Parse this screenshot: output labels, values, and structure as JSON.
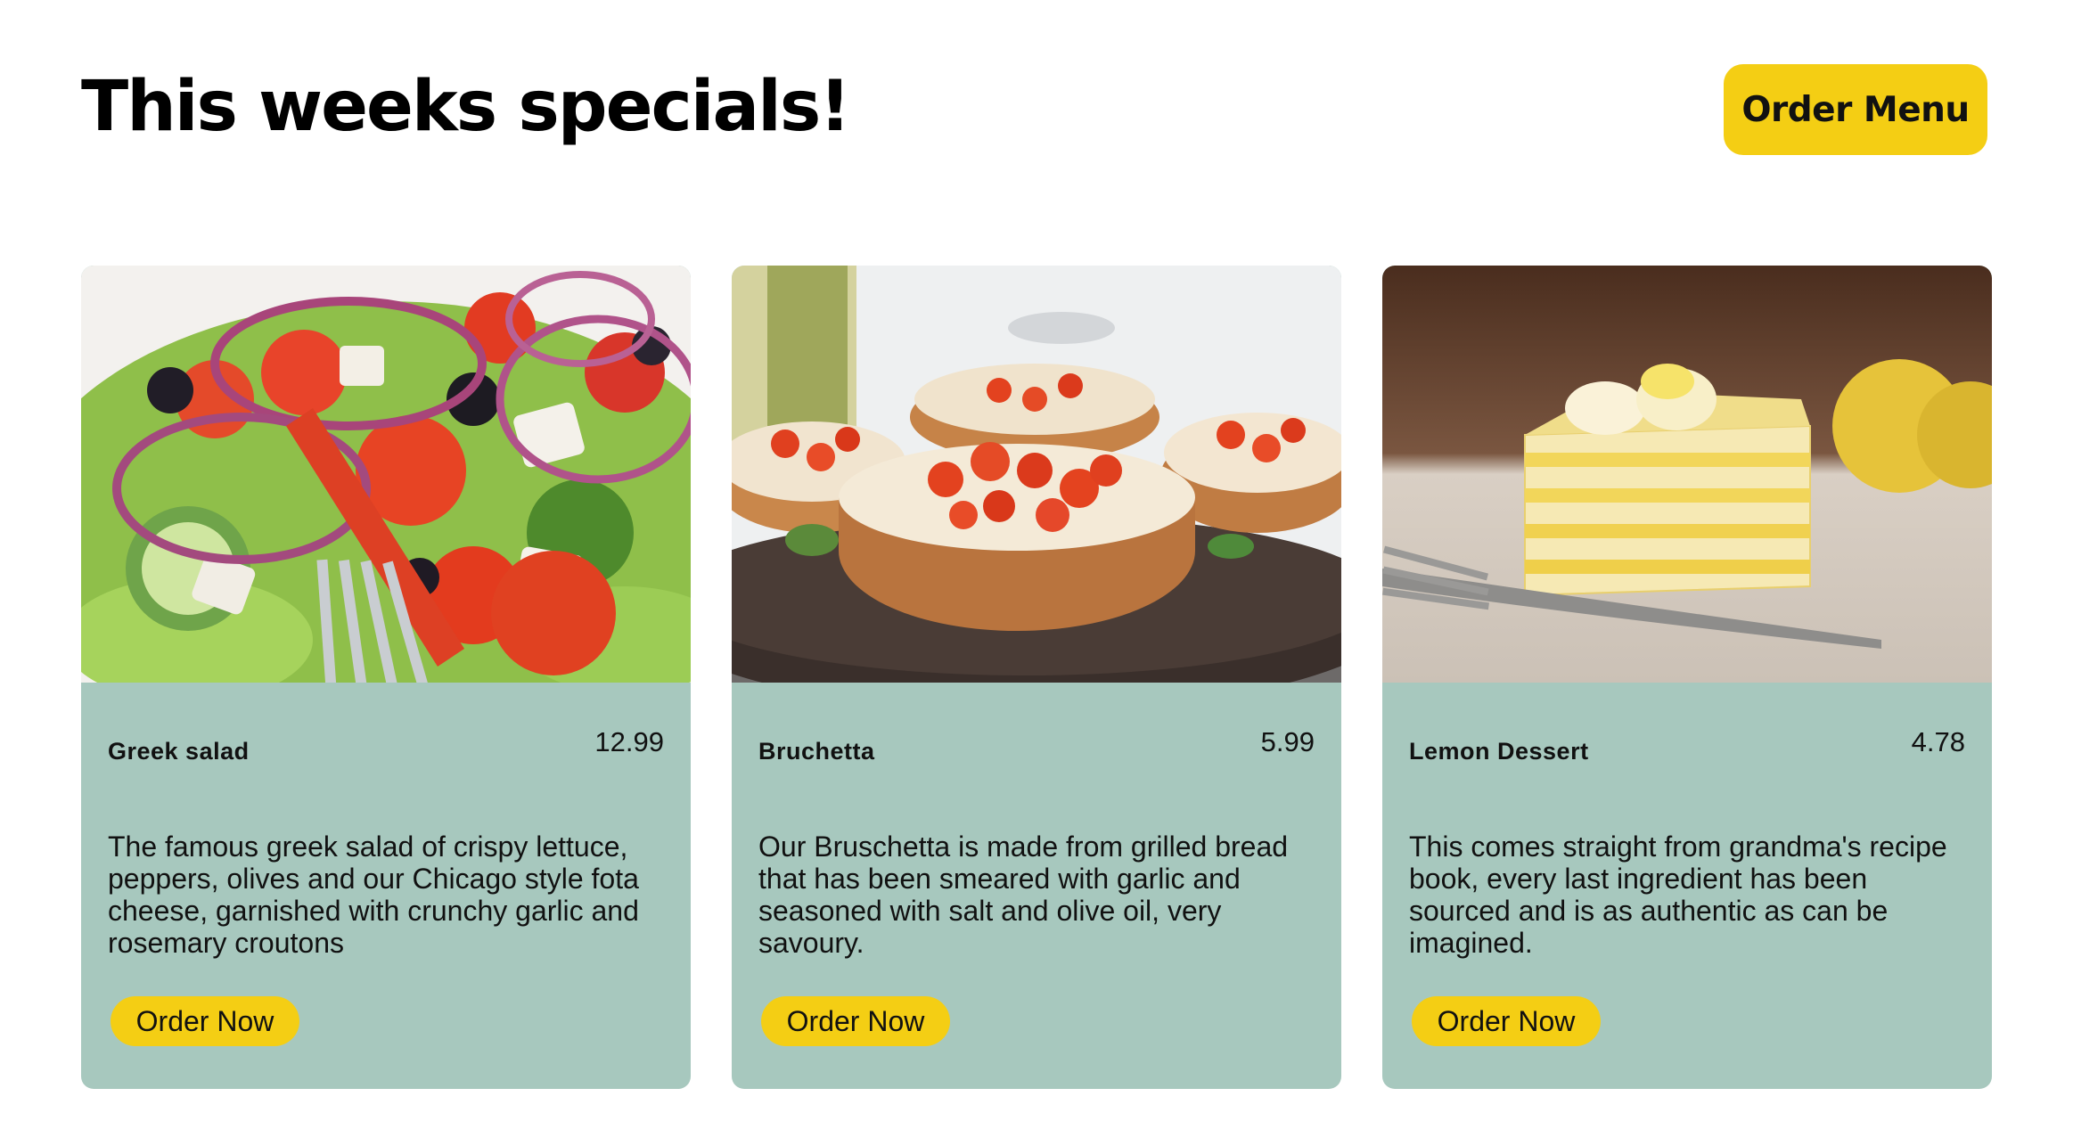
{
  "header": {
    "title": "This weeks specials!",
    "order_menu_label": "Order Menu"
  },
  "colors": {
    "accent_yellow": "#f4ce14",
    "card_background": "#a7c8be",
    "text": "#111111"
  },
  "cards": [
    {
      "name": "Greek salad",
      "price": "12.99",
      "description": "The famous greek salad of crispy lettuce, peppers, olives and our Chicago style fota cheese, garnished with crunchy garlic and rosemary croutons",
      "button_label": "Order Now",
      "image_icon": "greek-salad-photo"
    },
    {
      "name": "Bruchetta",
      "price": "5.99",
      "description": "Our Bruschetta is made from grilled bread that has been smeared with garlic and seasoned with salt and olive oil, very savoury.",
      "button_label": "Order Now",
      "image_icon": "bruschetta-photo"
    },
    {
      "name": "Lemon Dessert",
      "price": "4.78",
      "description": "This comes straight from grandma's recipe book, every last ingredient has been sourced and is as authentic as can be imagined.",
      "button_label": "Order Now",
      "image_icon": "lemon-dessert-photo"
    }
  ]
}
